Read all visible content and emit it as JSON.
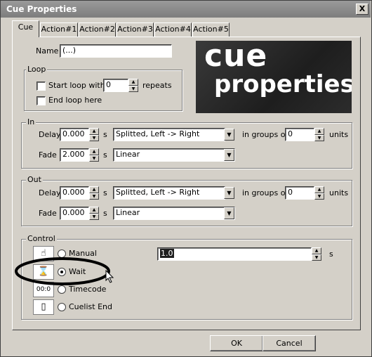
{
  "window": {
    "title": "Cue Properties",
    "close_glyph": "X"
  },
  "tabs": [
    "Cue",
    "Action#1",
    "Action#2",
    "Action#3",
    "Action#4",
    "Action#5"
  ],
  "name_field": {
    "label": "Name",
    "value": "(...)"
  },
  "loop": {
    "title": "Loop",
    "start_loop_label": "Start loop with",
    "start_loop_checked": false,
    "repeats_value": "0",
    "repeats_label": "repeats",
    "end_loop_label": "End loop here",
    "end_loop_checked": false
  },
  "logo": {
    "line1": "cue",
    "line2": "properties"
  },
  "in_group": {
    "title": "In",
    "delay_label": "Delay",
    "delay_value": "0.000",
    "delay_unit": "s",
    "delay_mode": "Splitted, Left -> Right",
    "groups_label": "in groups of",
    "groups_value": "0",
    "units_label": "units",
    "fade_label": "Fade",
    "fade_value": "2.000",
    "fade_unit": "s",
    "fade_mode": "Linear"
  },
  "out_group": {
    "title": "Out",
    "delay_label": "Delay",
    "delay_value": "0.000",
    "delay_unit": "s",
    "delay_mode": "Splitted, Left -> Right",
    "groups_label": "in groups of",
    "groups_value": "0",
    "units_label": "units",
    "fade_label": "Fade",
    "fade_value": "0.000",
    "fade_unit": "s",
    "fade_mode": "Linear"
  },
  "control": {
    "title": "Control",
    "options": [
      {
        "label": "Manual",
        "icon": "hand-icon",
        "glyph": "☝"
      },
      {
        "label": "Wait",
        "icon": "hourglass-icon",
        "glyph": "⌛"
      },
      {
        "label": "Timecode",
        "icon": "timecode-icon",
        "glyph": "00:0"
      },
      {
        "label": "Cuelist End",
        "icon": "cuelist-end-icon",
        "glyph": "▯"
      }
    ],
    "selected": "Wait",
    "wait_value": "1.0",
    "wait_unit": "s"
  },
  "buttons": {
    "ok": "OK",
    "cancel": "Cancel"
  }
}
